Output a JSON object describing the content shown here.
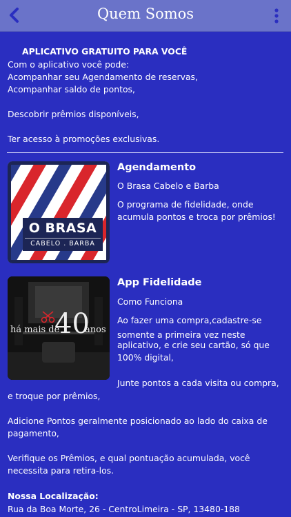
{
  "nav": {
    "title": "Quem Somos",
    "back_icon": "chevron-left-icon",
    "menu_icon": "more-vertical-icon"
  },
  "intro": {
    "heading": "APLICATIVO GRATUITO PARA VOCÊ",
    "lines": [
      "Com o aplicativo você pode:",
      "Acompanhar seu Agendamento de reservas,",
      "Acompanhar saldo de pontos,",
      "Descobrir prêmios disponíveis,",
      "Ter acesso à promoções exclusivas."
    ]
  },
  "section1": {
    "logo_text": "O BRASA",
    "logo_subtext": "CABELO . BARBA",
    "title": "Agendamento",
    "subtitle": "O Brasa Cabelo e Barba",
    "body": [
      "O programa de fidelidade, onde",
      "acumula pontos e troca por prêmios!"
    ]
  },
  "section2": {
    "image_text_left": "há mais de",
    "image_text_number": "40",
    "image_text_right": "anos",
    "title": "App Fidelidade",
    "subtitle": "Como Funciona",
    "body": [
      "Ao fazer uma compra,cadastre-se",
      "somente a primeira vez neste",
      "aplicativo, e crie seu cartão, só que",
      "100% digital,"
    ],
    "body_continued": [
      "Junte pontos a cada visita ou compra,",
      "e troque por prêmios,"
    ]
  },
  "more": {
    "p1": [
      "Adicione Pontos geralmente posicionado ao lado do caixa de",
      "pagamento,"
    ],
    "p2": [
      "Verifique os Prêmios, e qual pontuação acumulada, você",
      "necessita para retira-los."
    ]
  },
  "location": {
    "heading": "Nossa Localização:",
    "address": "Rua da Boa Morte, 26 - CentroLimeira - SP, 13480-188"
  },
  "colors": {
    "background": "#2a2ec0",
    "navbar": "#6a73c9",
    "barber_red": "#d9262c",
    "barber_navy": "#273a8a"
  }
}
